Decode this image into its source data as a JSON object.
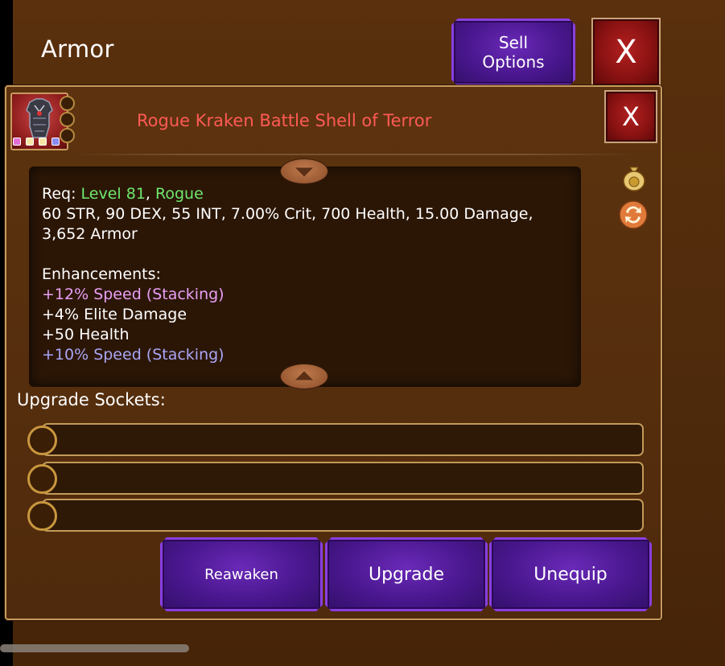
{
  "header": {
    "title": "Armor",
    "sell_options_label": "Sell\nOptions",
    "close_label": "X"
  },
  "item": {
    "name": "Rogue Kraken Battle Shell of Terror",
    "close_label": "X",
    "gem_colors": [
      "#e36fd6",
      "#f5e6a8",
      "#f5e6a8",
      "#8a8af0"
    ],
    "req_prefix": "Req: ",
    "req_level": "Level 81",
    "req_sep": ", ",
    "req_class": "Rogue",
    "stats_line1": "60 STR, 90 DEX, 55 INT, 7.00% Crit, 700 Health, 15.00 Damage,",
    "stats_line2": "3,652 Armor",
    "enhancements_label": "Enhancements:",
    "enhancements": [
      {
        "text": "+12% Speed (Stacking)",
        "color": "pink"
      },
      {
        "text": "+4% Elite Damage",
        "color": "white"
      },
      {
        "text": "+50 Health",
        "color": "white"
      },
      {
        "text": "+10% Speed (Stacking)",
        "color": "lavender"
      }
    ]
  },
  "side_icons": [
    "money-bag-icon",
    "swap-icon"
  ],
  "sockets": {
    "label": "Upgrade Sockets:",
    "count": 3
  },
  "actions": {
    "reawaken": "Reawaken",
    "upgrade": "Upgrade",
    "unequip": "Unequip"
  },
  "colors": {
    "item_name": "#ff5a55",
    "req_green": "#6ee86e",
    "enh_pink": "#e99ff5",
    "enh_lavender": "#a9a6f5",
    "button_purple": "#4a178f",
    "close_red": "#8a1212"
  }
}
